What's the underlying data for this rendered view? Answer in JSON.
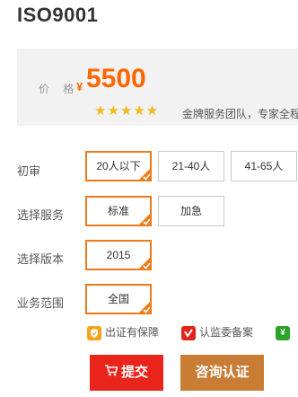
{
  "product": {
    "title": "ISO9001",
    "price_label": "价 格",
    "currency": "¥",
    "price": "5500",
    "stars": "★★★★★",
    "rating": 5,
    "slogan": "金牌服务团队，专家全程"
  },
  "options": {
    "headcount": {
      "label": "初审",
      "items": [
        "20人以下",
        "21-40人",
        "41-65人"
      ],
      "selected": "20人以下"
    },
    "service": {
      "label": "选择服务",
      "items": [
        "标准",
        "加急"
      ],
      "selected": "标准"
    },
    "version": {
      "label": "选择版本",
      "items": [
        "2015"
      ],
      "selected": "2015"
    },
    "scope": {
      "label": "业务范围",
      "items": [
        "全国"
      ],
      "selected": "全国"
    }
  },
  "guarantees": [
    {
      "icon": "shield-icon",
      "label": "出证有保障",
      "color": "#f5a31a"
    },
    {
      "icon": "check-badge-icon",
      "label": "认监委备案",
      "color": "#e0241b"
    },
    {
      "icon": "yen-icon",
      "label": "¥",
      "color": "#2aa52a"
    }
  ],
  "actions": {
    "submit": "提交",
    "consult": "咨询认证"
  },
  "colors": {
    "accent": "#ee7a1a",
    "price": "#ff6600",
    "submit": "#e8241b",
    "consult": "#c87c34"
  }
}
